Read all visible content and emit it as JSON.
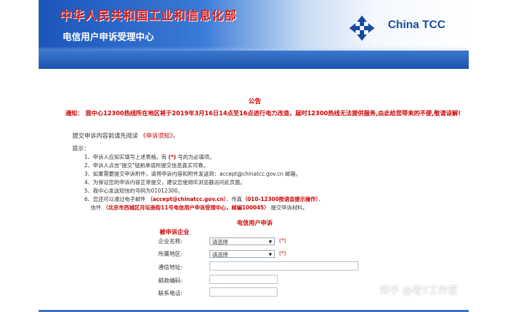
{
  "header": {
    "ministry": "中华人民共和国工业和信息化部",
    "center": "电信用户申诉受理中心",
    "logo_text": "China TCC"
  },
  "notice": {
    "title": "公告",
    "body": "通知： 我中心12300热线所在地区将于2019年3月16日14点至16点进行电力改造，届时12300热线无法提供服务,由此给您带来的不便,敬请谅解!"
  },
  "hint": {
    "text": "提交申诉内容前请先阅读",
    "link": "《申诉须知》",
    "end": "。"
  },
  "tips": {
    "label": "提示：",
    "items": [
      {
        "pre": "1、申诉人应如实填写上述表格。有 ",
        "mark": "(*)",
        "post": " 号的为必填项。"
      },
      {
        "pre": "2、申诉人点击\"提交\"钮前承诺所提交信息真实可靠。",
        "mark": "",
        "post": ""
      },
      {
        "pre": "3、如果需要提交申诉附件，请将申诉内容和附件发送到：accept@chinatcc.gov.cn 邮箱。",
        "mark": "",
        "post": ""
      },
      {
        "pre": "4、为保证您的申诉内容正常提交，建议您使用IE浏览器访问此页面。",
        "mark": "",
        "post": ""
      },
      {
        "pre": "5、我中心发送短信的号码为01012300。",
        "mark": "",
        "post": ""
      },
      {
        "pre": "6、您还可以通过电子邮件 ",
        "mark": "（accept@chinatcc.gov.cn）",
        "post": "、传真",
        "mark2": "（010-12300按语音提示操作）",
        "post2": "、"
      },
      {
        "pre": "信件 ",
        "mark": "（北京市西城区月坛南街11号电信用户申诉受理中心，邮编100045）",
        "post": " 提交申诉材料。"
      }
    ]
  },
  "form": {
    "title": "电信用户申诉",
    "section": "被申诉企业",
    "company_label": "企业名称:",
    "company_value": "请选择",
    "region_label": "所属地区:",
    "region_value": "请选择",
    "required_mark": "(*)",
    "address_label": "通信地址:",
    "postcode_label": "邮政编码:",
    "phone_label": "联系电话:"
  },
  "watermark": "知乎 @老Y工作室",
  "colors": {
    "header_blue": "#1b55b8",
    "accent_red": "#cc0000"
  }
}
